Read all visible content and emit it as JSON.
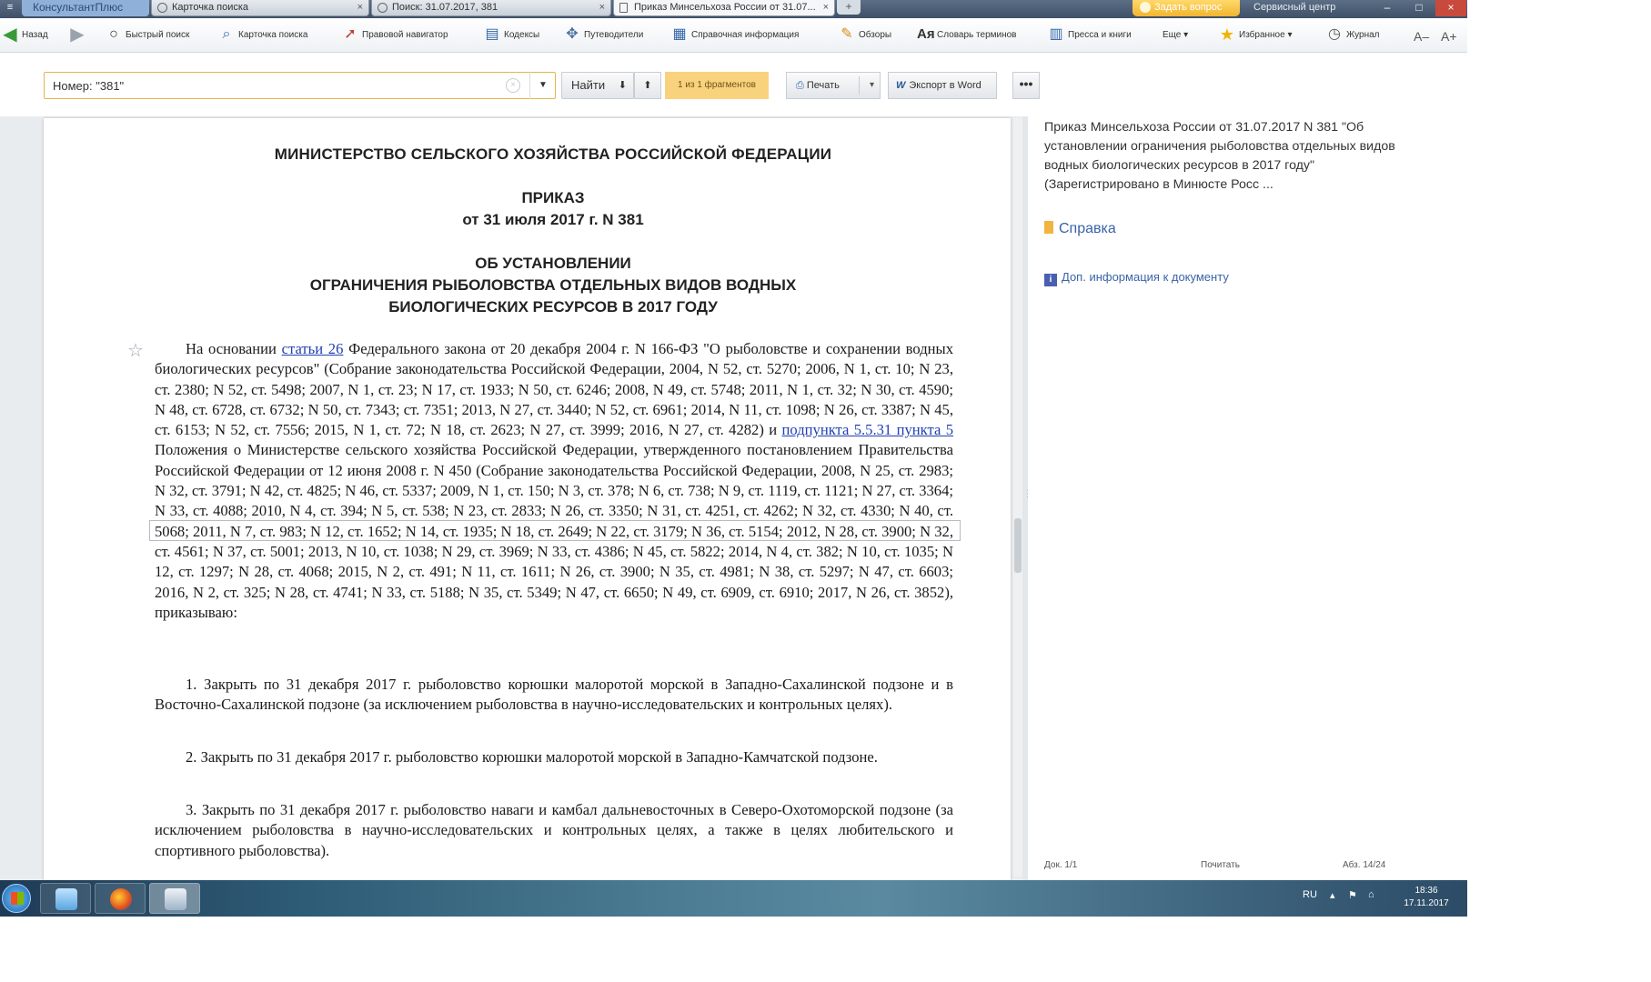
{
  "tabs": {
    "menu": "≡",
    "brand": "КонсультантПлюс",
    "items": [
      {
        "label": "Карточка поиска"
      },
      {
        "label": "Поиск: 31.07.2017, 381"
      },
      {
        "label": "Приказ Минсельхоза России от 31.07..."
      }
    ],
    "new_tab": "+",
    "ask_question": "Задать вопрос",
    "service_center": "Сервисный центр",
    "close_glyph": "×"
  },
  "toolbar": {
    "back": "Назад",
    "quick_search": "Быстрый поиск",
    "search_card": "Карточка поиска",
    "legal_navigator": "Правовой навигатор",
    "codexes": "Кодексы",
    "guides": "Путеводители",
    "reference_info": "Справочная информация",
    "reviews": "Обзоры",
    "dictionary": "Словарь терминов",
    "press": "Пресса и книги",
    "more": "Еще",
    "favorites": "Избранное",
    "journal": "Журнал",
    "font_smaller": "A–",
    "font_larger": "A+"
  },
  "search": {
    "value": "Номер: \"381\"",
    "find_label": "Найти",
    "fragments": "1 из 1 фрагментов",
    "print_label": "Печать",
    "export_word": "Экспорт в Word",
    "more": "•••"
  },
  "document": {
    "ministry": "МИНИСТЕРСТВО СЕЛЬСКОГО ХОЗЯЙСТВА РОССИЙСКОЙ ФЕДЕРАЦИИ",
    "order_title": "ПРИКАЗ",
    "order_date": "от 31 июля 2017 г. N 381",
    "subject_1": "ОБ УСТАНОВЛЕНИИ",
    "subject_2": "ОГРАНИЧЕНИЯ РЫБОЛОВСТВА ОТДЕЛЬНЫХ ВИДОВ ВОДНЫХ",
    "subject_3": "БИОЛОГИЧЕСКИХ РЕСУРСОВ В 2017 ГОДУ",
    "p1_start": "На основании ",
    "p1_link1": "статьи 26",
    "p1_mid": " Федерального закона от 20 декабря 2004 г. N 166-ФЗ \"О рыболовстве и сохранении водных биологических ресурсов\" (Собрание законодательства Российской Федерации, 2004, N 52, ст. 5270; 2006, N 1, ст. 10; N 23, ст. 2380; N 52, ст. 5498; 2007, N 1, ст. 23; N 17, ст. 1933; N 50, ст. 6246; 2008, N 49, ст. 5748; 2011, N 1, ст. 32; N 30, ст. 4590; N 48, ст. 6728, ст. 6732; N 50, ст. 7343; ст. 7351; 2013, N 27, ст. 3440; N 52, ст. 6961; 2014, N 11, ст. 1098; N 26, ст. 3387; N 45, ст. 6153; N 52, ст. 7556; 2015, N 1, ст. 72; N 18, ст. 2623; N 27, ст. 3999; 2016, N 27, ст. 4282) и ",
    "p1_link2": "подпункта 5.5.31 пункта 5",
    "p1_end": " Положения о Министерстве сельского хозяйства Российской Федерации, утвержденного постановлением Правительства Российской Федерации от 12 июня 2008 г. N 450 (Собрание законодательства Российской Федерации, 2008, N 25, ст. 2983; N 32, ст. 3791; N 42, ст. 4825; N 46, ст. 5337; 2009, N 1, ст. 150; N 3, ст. 378; N 6, ст. 738; N 9, ст. 1119, ст. 1121; N 27, ст. 3364; N 33, ст. 4088; 2010, N 4, ст. 394; N 5, ст. 538; N 23, ст. 2833; N 26, ст. 3350; N 31, ст. 4251, ст. 4262; N 32, ст. 4330; N 40, ст. 5068; 2011, N 7, ст. 983; N 12, ст. 1652; N 14, ст. 1935; N 18, ст. 2649; N 22, ст. 3179; N 36, ст. 5154; 2012, N 28, ст. 3900; N 32, ст. 4561; N 37, ст. 5001; 2013, N 10, ст. 1038; N 29, ст. 3969; N 33, ст. 4386; N 45, ст. 5822; 2014, N 4, ст. 382; N 10, ст. 1035; N 12, ст. 1297; N 28, ст. 4068; 2015, N 2, ст. 491; N 11, ст. 1611; N 26, ст. 3900; N 35, ст. 4981; N 38, ст. 5297; N 47, ст. 6603; 2016, N 2, ст. 325; N 28, ст. 4741; N 33, ст. 5188; N 35, ст. 5349; N 47, ст. 6650; N 49, ст. 6909, ст. 6910; 2017, N 26, ст. 3852), приказываю:",
    "p2": "1. Закрыть по 31 декабря 2017 г. рыболовство корюшки малоротой морской в Западно-Сахалинской подзоне и в Восточно-Сахалинской подзоне (за исключением рыболовства в научно-исследовательских и контрольных целях).",
    "p3": "2. Закрыть по 31 декабря 2017 г. рыболовство корюшки малоротой морской в Западно-Камчатской подзоне.",
    "p4": "3. Закрыть по 31 декабря 2017 г. рыболовство наваги и камбал дальневосточных в Северо-Охотоморской подзоне (за исключением рыболовства в научно-исследовательских и контрольных целях, а также в целях любительского и спортивного рыболовства)."
  },
  "sidebar": {
    "doc_title": "Приказ Минсельхоза России от 31.07.2017 N 381 \"Об установлении ограничения рыболовства отдельных видов водных биологических ресурсов в 2017 году\" (Зарегистрировано в Минюсте Росс ...",
    "reference": "Справка",
    "extra_info": "Доп. информация к документу",
    "doc_count": "Док. 1/1",
    "read": "Почитать",
    "paragraph": "Абз. 14/24"
  },
  "taskbar": {
    "lang": "RU",
    "time": "18:36",
    "date": "17.11.2017"
  },
  "colors": {
    "accent_yellow": "#f9d27e",
    "link_blue": "#1f3fb4",
    "sidebar_blue": "#3b63a8"
  }
}
